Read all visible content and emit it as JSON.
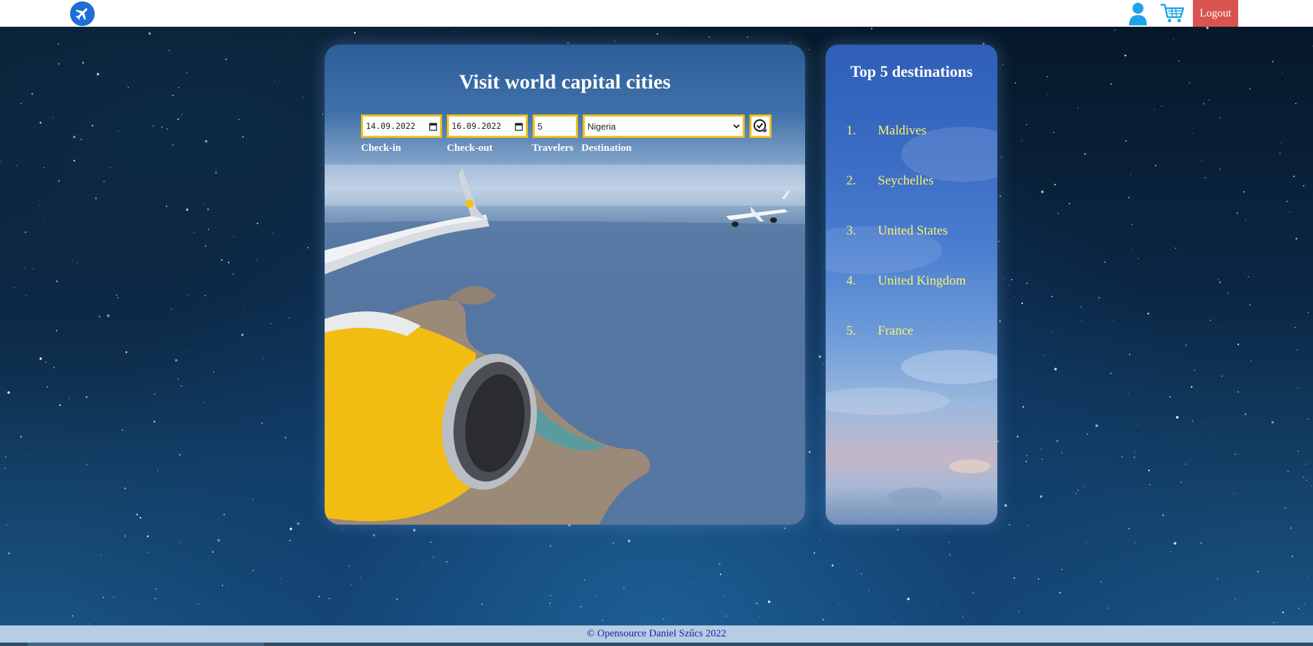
{
  "header": {
    "logo_icon": "airplane-icon",
    "user_icon": "user-icon",
    "cart_icon": "shopping-cart-icon",
    "logout_label": "Logout",
    "accent_color": "#1f6ed4",
    "logout_color": "#d9534f"
  },
  "search": {
    "title": "Visit world capital cities",
    "checkin_value": "14.09.2022",
    "checkout_value": "16.09.2022",
    "travelers_value": "5",
    "destination_value": "Nigeria",
    "submit_icon": "check-circle-icon",
    "labels": {
      "checkin": "Check-in",
      "checkout": "Check-out",
      "travelers": "Travelers",
      "destination": "Destination"
    },
    "input_border_color": "#f2c318"
  },
  "top_destinations": {
    "title": "Top 5 destinations",
    "items": [
      {
        "num": "1.",
        "name": "Maldives"
      },
      {
        "num": "2.",
        "name": "Seychelles"
      },
      {
        "num": "3.",
        "name": "United States"
      },
      {
        "num": "4.",
        "name": "United Kingdom"
      },
      {
        "num": "5.",
        "name": "France"
      }
    ],
    "text_color": "#f7f36a"
  },
  "footer": {
    "text": "© Opensource Daniel Szűcs 2022"
  }
}
